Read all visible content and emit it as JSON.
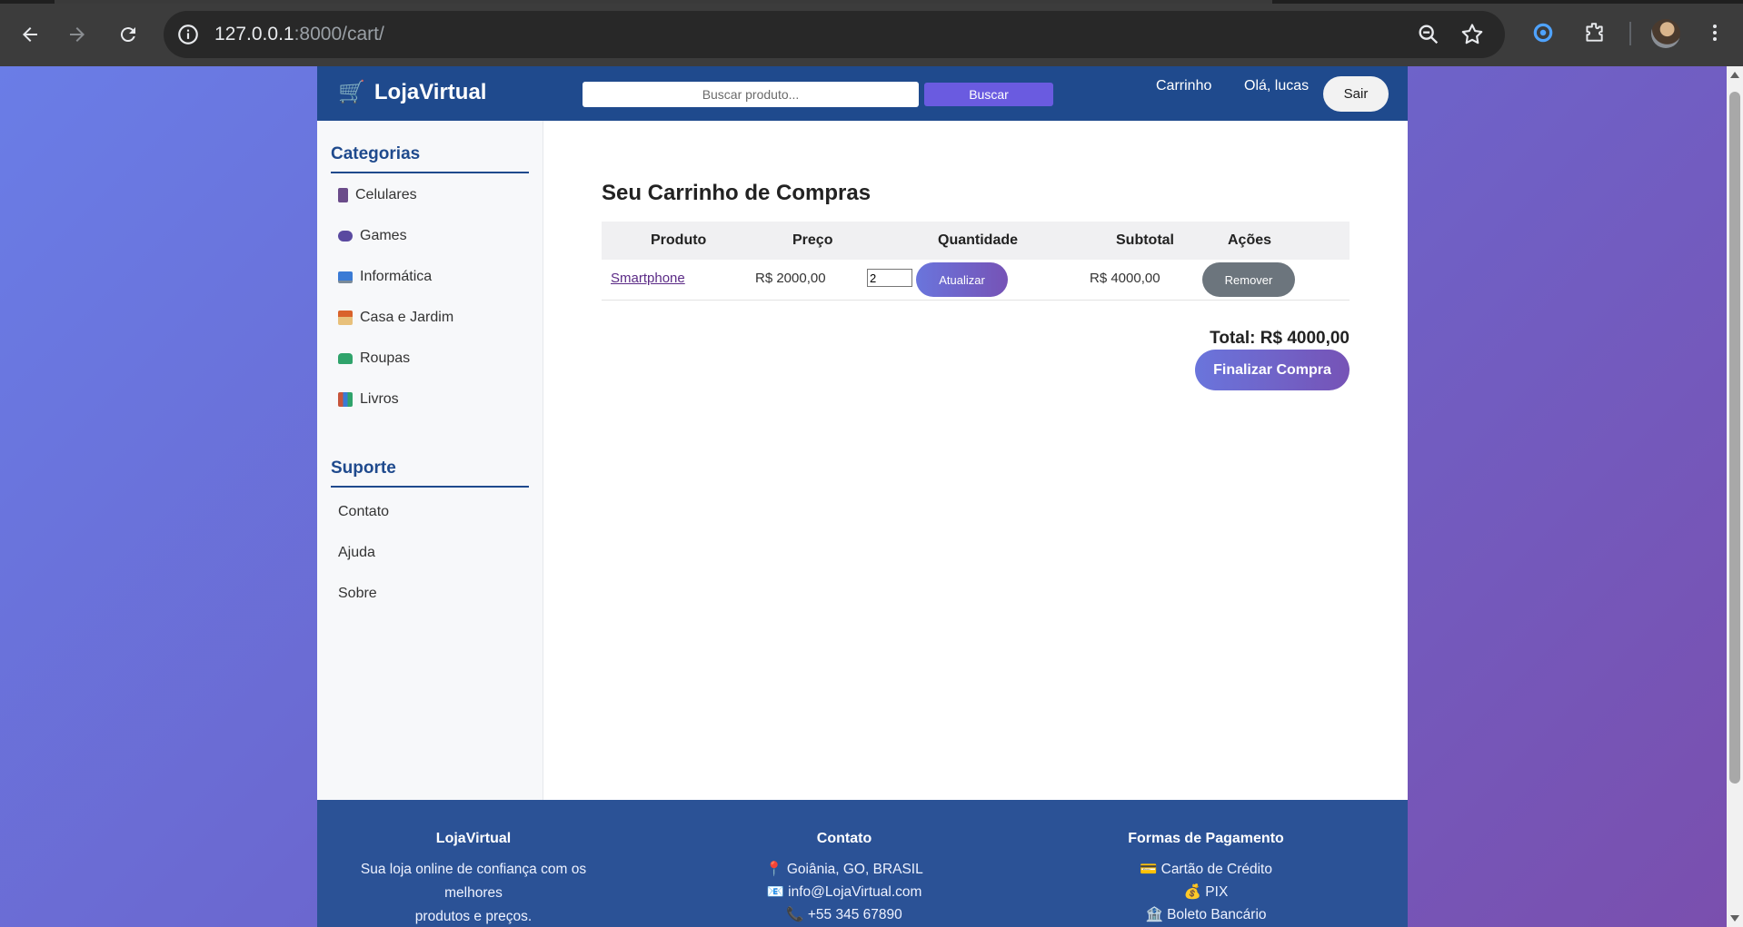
{
  "browser": {
    "url_host": "127.0.0.1",
    "url_rest": ":8000/cart/"
  },
  "header": {
    "logo_icon": "🛒",
    "logo_text": "LojaVirtual",
    "search_placeholder": "Buscar produto...",
    "search_button": "Buscar",
    "nav_cart": "Carrinho",
    "nav_greeting": "Olá, lucas",
    "logout_button": "Sair"
  },
  "sidebar": {
    "categories_title": "Categorias",
    "categories": [
      {
        "label": "Celulares",
        "icon": "phone-icon",
        "color": "#6b4c8a"
      },
      {
        "label": "Games",
        "icon": "gamepad-icon",
        "color": "#5a4aa0"
      },
      {
        "label": "Informática",
        "icon": "computer-icon",
        "color": "#3a7bd5"
      },
      {
        "label": "Casa e Jardim",
        "icon": "house-icon",
        "color": "#d9622b"
      },
      {
        "label": "Roupas",
        "icon": "tshirt-icon",
        "color": "#2fa36b"
      },
      {
        "label": "Livros",
        "icon": "books-icon",
        "color": "#c7553b"
      }
    ],
    "support_title": "Suporte",
    "support": [
      {
        "label": "Contato"
      },
      {
        "label": "Ajuda"
      },
      {
        "label": "Sobre"
      }
    ]
  },
  "cart": {
    "title": "Seu Carrinho de Compras",
    "columns": [
      "Produto",
      "Preço",
      "Quantidade",
      "Subtotal",
      "Ações"
    ],
    "rows": [
      {
        "product": "Smartphone",
        "price": "R$ 2000,00",
        "quantity": "2",
        "update_button": "Atualizar",
        "subtotal": "R$ 4000,00",
        "remove_button": "Remover"
      }
    ],
    "total": "Total: R$ 4000,00",
    "checkout_button": "Finalizar Compra"
  },
  "footer": {
    "about_title": "LojaVirtual",
    "about_text_1": "Sua loja online de confiança com os melhores",
    "about_text_2": "produtos e preços.",
    "contact_title": "Contato",
    "contact_location": "📍 Goiânia, GO, BRASIL",
    "contact_email": "📧 info@LojaVirtual.com",
    "contact_phone": "📞 +55 345 67890",
    "payment_title": "Formas de Pagamento",
    "payment_card": "💳 Cartão de Crédito",
    "payment_pix": "💰 PIX",
    "payment_boleto": "🏦 Boleto Bancário"
  },
  "colors": {
    "brand_blue": "#1f4a8d",
    "accent_purple": "#6a5be0",
    "remove_gray": "#6c757d"
  }
}
